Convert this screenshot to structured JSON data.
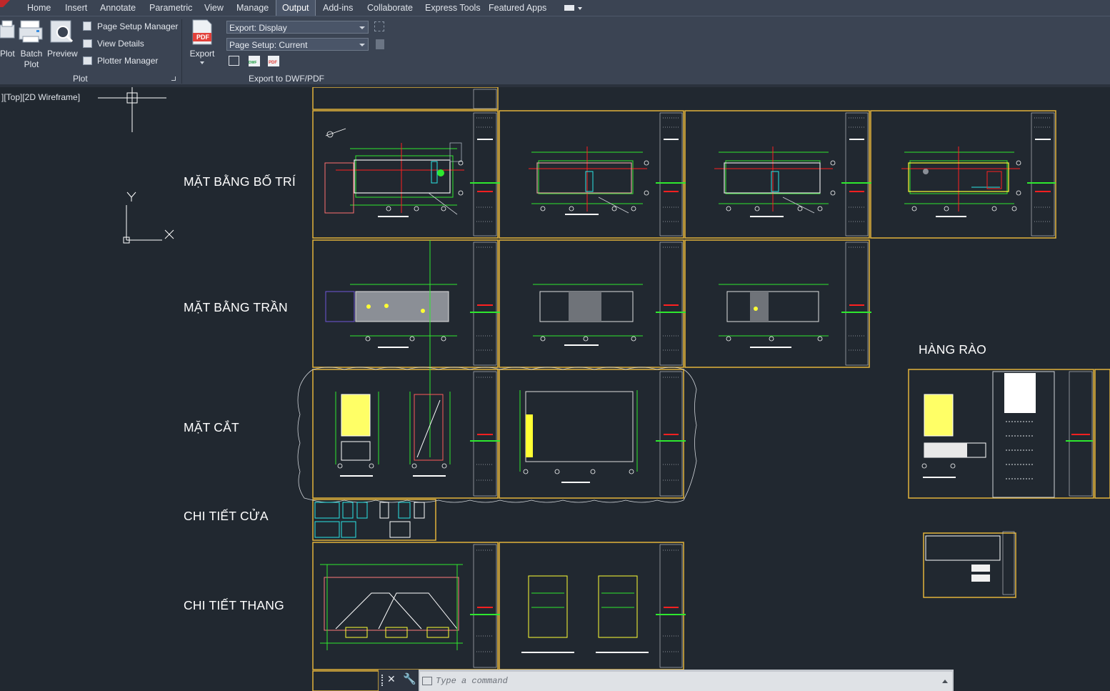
{
  "ribbon_tabs": [
    "Home",
    "Insert",
    "Annotate",
    "Parametric",
    "View",
    "Manage",
    "Output",
    "Add-ins",
    "Collaborate",
    "Express Tools",
    "Featured Apps"
  ],
  "active_tab": "Output",
  "plot_panel": {
    "title": "Plot",
    "plot_label": "Plot",
    "batch_plot_label": "Batch Plot",
    "preview_label": "Preview",
    "page_setup_manager": "Page Setup Manager",
    "view_details": "View Details",
    "plotter_manager": "Plotter Manager"
  },
  "export_panel": {
    "title": "Export to DWF/PDF",
    "export_label": "Export",
    "export_combo": "Export: Display",
    "page_setup_combo": "Page Setup: Current",
    "pdf_badge": "PDF",
    "dwf_badge": "DWF"
  },
  "viewport_label": "][Top][2D Wireframe]",
  "ucs": {
    "y": "Y",
    "x": "X"
  },
  "drawing_labels": {
    "mat_bang_bo_tri": "MẶT BẰNG BỐ TRÍ",
    "mat_bang_tran": "MẶT BẰNG TRẦN",
    "mat_cat": "MẶT CẮT",
    "chi_tiet_cua": "CHI TIẾT CỬA",
    "chi_tiet_thang": "CHI TIẾT THANG",
    "hang_rao": "HÀNG RÀO"
  },
  "command_line": {
    "placeholder": "Type a command"
  },
  "colors": {
    "sheet_border": "#e3b33a",
    "canvas": "#212830",
    "ribbon": "#3b4453",
    "accent_green": "#2ee82e",
    "accent_red": "#ff2020",
    "accent_cyan": "#2ae6e6",
    "accent_yellow": "#ffff33"
  }
}
